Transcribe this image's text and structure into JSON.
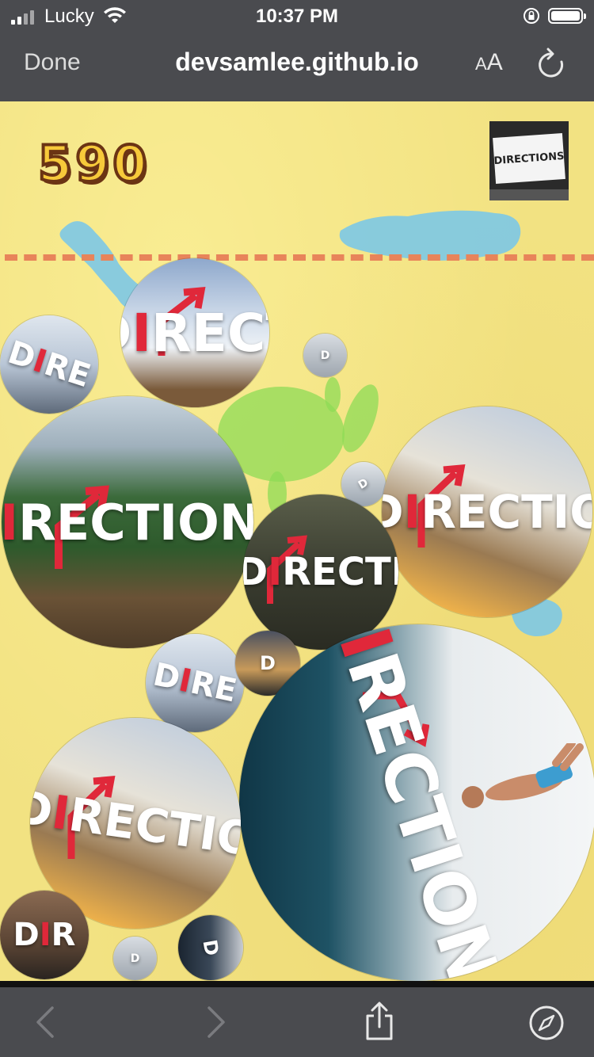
{
  "status_bar": {
    "carrier": "Lucky",
    "time": "10:37 PM",
    "battery_level": 1.0
  },
  "browser": {
    "done_label": "Done",
    "url": "devsamlee.github.io",
    "text_size_label_small": "A",
    "text_size_label_large": "A"
  },
  "game": {
    "score": "590",
    "next_label": "DIRECTIONS",
    "balls": [
      {
        "label_pre": "D",
        "label_i": "I",
        "label_post": "RECT"
      },
      {
        "label_pre": "D",
        "label_i": "I",
        "label_post": "RE"
      },
      {
        "label_pre": "",
        "label_i": "",
        "label_post": "D"
      },
      {
        "label_pre": "D",
        "label_i": "I",
        "label_post": "RECTIONS"
      },
      {
        "label_pre": "",
        "label_i": "",
        "label_post": "D"
      },
      {
        "label_pre": "D",
        "label_i": "I",
        "label_post": "RECTIO"
      },
      {
        "label_pre": "D",
        "label_i": "I",
        "label_post": "RECTI"
      },
      {
        "label_pre": "D",
        "label_i": "I",
        "label_post": "RE"
      },
      {
        "label_pre": "D",
        "label_i": "",
        "label_post": ""
      },
      {
        "label_pre": "D",
        "label_i": "I",
        "label_post": "RECTIONS"
      },
      {
        "label_pre": "D",
        "label_i": "I",
        "label_post": "RECTIO"
      },
      {
        "label_pre": "D",
        "label_i": "I",
        "label_post": "R"
      },
      {
        "label_pre": "",
        "label_i": "",
        "label_post": "D"
      },
      {
        "label_pre": "D",
        "label_i": "",
        "label_post": ""
      }
    ]
  },
  "colors": {
    "chrome": "#4a4b4f",
    "background": "#f2e282",
    "danger_line": "#e8845a",
    "score_fill": "#f7c93a",
    "score_outline": "#6b3414",
    "accent_red": "#e0283a"
  }
}
